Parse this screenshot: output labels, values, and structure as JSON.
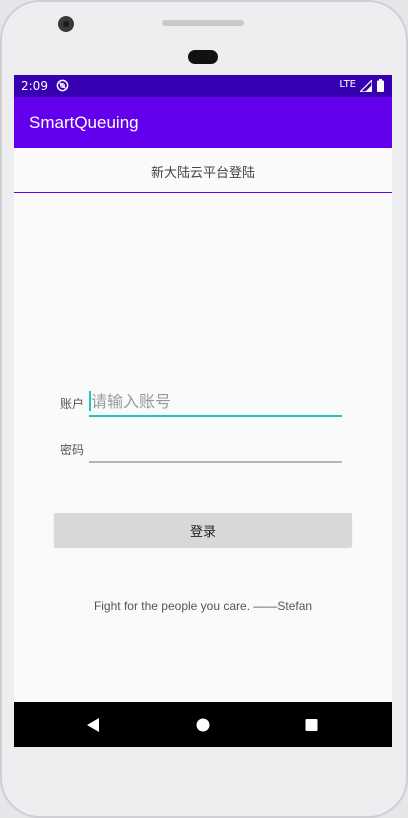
{
  "status_bar": {
    "time": "2:09",
    "network": "LTE"
  },
  "app_bar": {
    "title": "SmartQueuing"
  },
  "header": {
    "title": "新大陆云平台登陆"
  },
  "form": {
    "account_label": "账户",
    "account_placeholder": "请输入账号",
    "account_value": "",
    "password_label": "密码",
    "password_value": "",
    "login_button": "登录"
  },
  "footer": {
    "quote": "Fight for the people you care. ——Stefan"
  },
  "icons": {
    "data_saver": "data-saver-icon",
    "signal": "signal-icon",
    "battery": "battery-icon",
    "back": "back-icon",
    "home": "home-icon",
    "recents": "recents-icon"
  },
  "colors": {
    "status_bar": "#3700b3",
    "app_bar": "#6200ee",
    "accent": "#18c7c2",
    "button": "#d7d8d9"
  }
}
